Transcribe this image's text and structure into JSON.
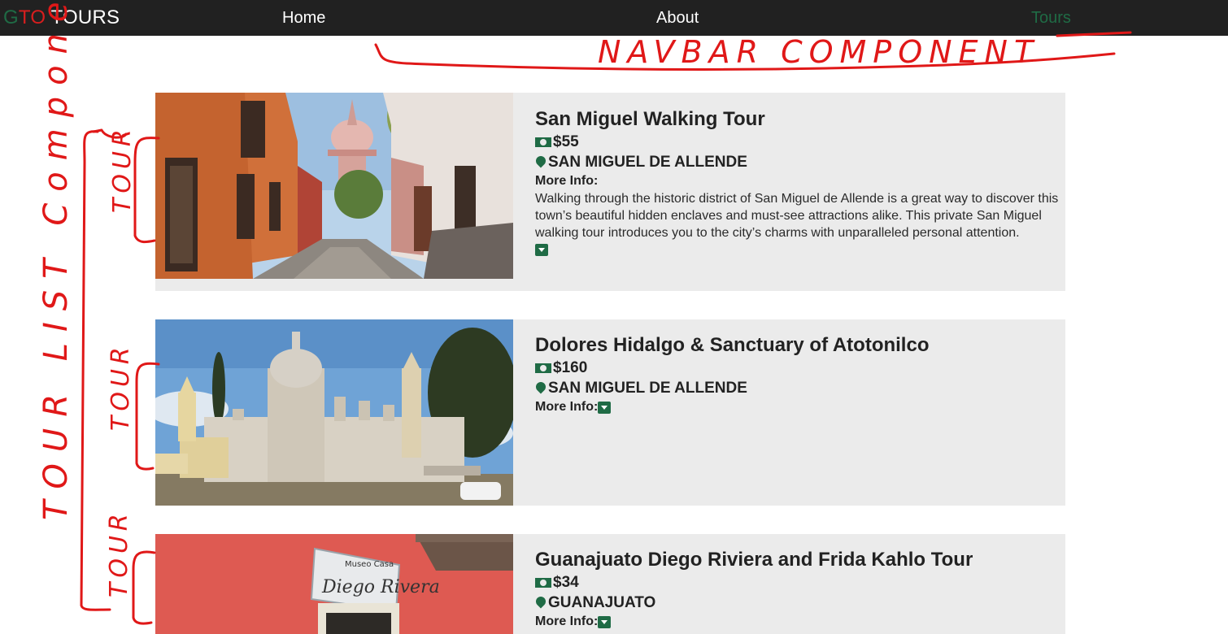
{
  "navbar": {
    "brand": {
      "letters": [
        {
          "char": "G",
          "color": "#1f6b45"
        },
        {
          "char": "T",
          "color": "#d81e1e"
        },
        {
          "char": "O",
          "color": "#d81e1e"
        }
      ],
      "suffix": " TOURS",
      "suffix_color": "#ffffff"
    },
    "links": [
      {
        "label": "Home",
        "active": false
      },
      {
        "label": "About",
        "active": false
      },
      {
        "label": "Tours",
        "active": true
      }
    ],
    "active_color": "#1f6b45"
  },
  "tours": [
    {
      "title": "San Miguel Walking Tour",
      "price": "$55",
      "location": "SAN MIGUEL DE ALLENDE",
      "more_info_label": "More Info:",
      "description": "Walking through the historic district of San Miguel de Allende is a great way to discover this town’s beautiful hidden enclaves and must-see attractions alike. This private San Miguel walking tour introduces you to the city’s charms with unparalleled personal attention.",
      "expanded": true,
      "image": "san-miguel-street-photo"
    },
    {
      "title": "Dolores Hidalgo & Sanctuary of Atotonilco",
      "price": "$160",
      "location": "SAN MIGUEL DE ALLENDE",
      "more_info_label": "More Info:",
      "description": "",
      "expanded": false,
      "image": "atotonilco-sanctuary-photo"
    },
    {
      "title": "Guanajuato Diego Riviera and Frida Kahlo Tour",
      "price": "$34",
      "location": "GUANAJUATO",
      "more_info_label": "More Info:",
      "description": "",
      "expanded": false,
      "image": "museo-casa-diego-rivera-photo",
      "sign_text": {
        "line1": "Museo Casa",
        "line2": "Diego Rivera"
      }
    }
  ],
  "annotations": {
    "navbar": "NAVBAR COMPONENT",
    "tour_list": "TOUR LIST Component",
    "tour": "TOUR",
    "color": "#e01818"
  },
  "icons": {
    "price": "money-icon",
    "location": "map-pin-icon",
    "toggle": "caret-square-down-icon"
  },
  "colors": {
    "navbar_bg": "#212121",
    "card_bg": "#ebebeb",
    "accent_green": "#1f6b45",
    "accent_red": "#d81e1e"
  }
}
